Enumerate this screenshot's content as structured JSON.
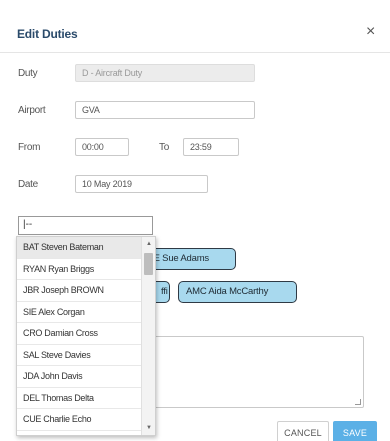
{
  "dialog": {
    "title": "Edit Duties",
    "close_glyph": "×"
  },
  "form": {
    "duty_label": "Duty",
    "duty_value": "D - Aircraft Duty",
    "airport_label": "Airport",
    "airport_value": "GVA",
    "from_label": "From",
    "from_value": "00:00",
    "to_label": "To",
    "to_value": "23:59",
    "date_label": "Date",
    "date_value": "10 May 2019"
  },
  "crew_search": {
    "value": "|--"
  },
  "selected_crew": [
    {
      "label": "TE Sue Adams"
    },
    {
      "label": "ffi"
    },
    {
      "label": "AMC Aida McCarthy"
    }
  ],
  "dropdown": {
    "items": [
      "BAT Steven Bateman",
      "RYAN Ryan Briggs",
      "JBR Joseph BROWN",
      "SIE Alex Corgan",
      "CRO Damian Cross",
      "SAL Steve Davies",
      "JDA John Davis",
      "DEL Thomas Delta",
      "CUE Charlie Echo"
    ],
    "scroll_up_icon": "triangle-up",
    "scroll_down_icon": "triangle-down"
  },
  "buttons": {
    "cancel": "CANCEL",
    "save": "SAVE"
  },
  "colors": {
    "title": "#2b4b6b",
    "chip_bg": "#a8d9ee",
    "chip_border": "#2f3a45",
    "save_bg": "#5bb0e6"
  }
}
